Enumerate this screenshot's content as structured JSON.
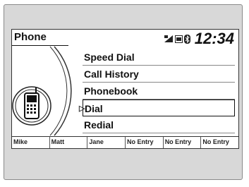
{
  "screen": {
    "title": "Phone",
    "clock": "12:34",
    "status_icons": [
      "signal-icon",
      "roaming-icon",
      "bluetooth-icon"
    ]
  },
  "menu": {
    "items": [
      {
        "label": "Speed Dial",
        "selected": false
      },
      {
        "label": "Call History",
        "selected": false
      },
      {
        "label": "Phonebook",
        "selected": false
      },
      {
        "label": "Dial",
        "selected": true
      },
      {
        "label": "Redial",
        "selected": false
      }
    ]
  },
  "quick_dial": [
    "Mike",
    "Matt",
    "Jane",
    "No Entry",
    "No Entry",
    "No Entry"
  ],
  "colors": {
    "background": "#d8d8d8",
    "screen": "#ffffff",
    "text": "#111111"
  }
}
